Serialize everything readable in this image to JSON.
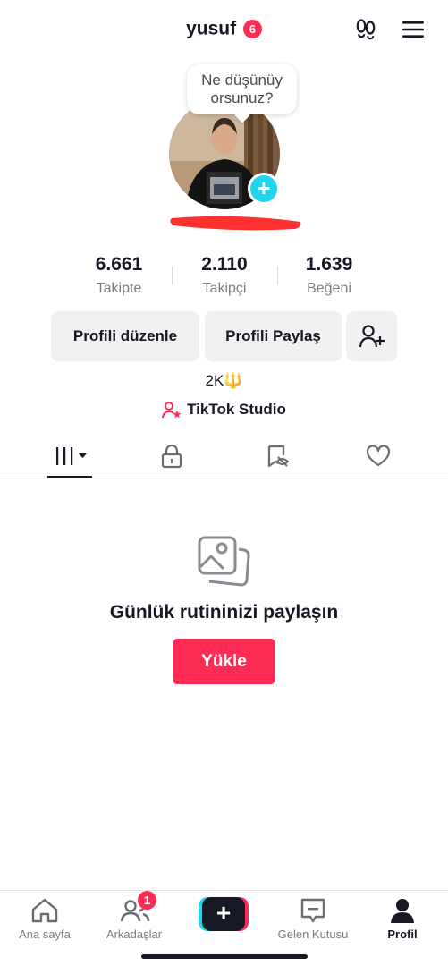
{
  "header": {
    "username": "yusuf",
    "notification_count": "6",
    "footprints_icon": "footprints-icon",
    "menu_icon": "hamburger-menu-icon"
  },
  "profile": {
    "thought_bubble": "Ne düşünüy orsunuz?",
    "avatar_add_icon": "plus-icon"
  },
  "stats": [
    {
      "value": "6.661",
      "label": "Takipte"
    },
    {
      "value": "2.110",
      "label": "Takipçi"
    },
    {
      "value": "1.639",
      "label": "Beğeni"
    }
  ],
  "actions": {
    "edit_profile": "Profili düzenle",
    "share_profile": "Profili Paylaş",
    "add_friend_icon": "add-user-icon"
  },
  "bio": "2K🔱",
  "studio": {
    "label": "TikTok Studio",
    "icon": "person-star-icon"
  },
  "tabs": [
    {
      "icon": "grid-icon",
      "active": true
    },
    {
      "icon": "lock-icon",
      "active": false
    },
    {
      "icon": "bookmark-eye-icon",
      "active": false
    },
    {
      "icon": "heart-icon",
      "active": false
    }
  ],
  "empty_state": {
    "icon": "photos-icon",
    "title": "Günlük rutininizi paylaşın",
    "button": "Yükle"
  },
  "bottom_nav": {
    "items": [
      {
        "label": "Ana sayfa",
        "icon": "home-icon"
      },
      {
        "label": "Arkadaşlar",
        "icon": "friends-icon",
        "badge": "1"
      },
      {
        "label": "",
        "icon": "create-plus-icon"
      },
      {
        "label": "Gelen Kutusu",
        "icon": "inbox-icon"
      },
      {
        "label": "Profil",
        "icon": "profile-icon",
        "active": true
      }
    ]
  },
  "colors": {
    "accent": "#fe2c55",
    "avatar_plus": "#20d5ec",
    "redaction": "#ff1a1a"
  }
}
